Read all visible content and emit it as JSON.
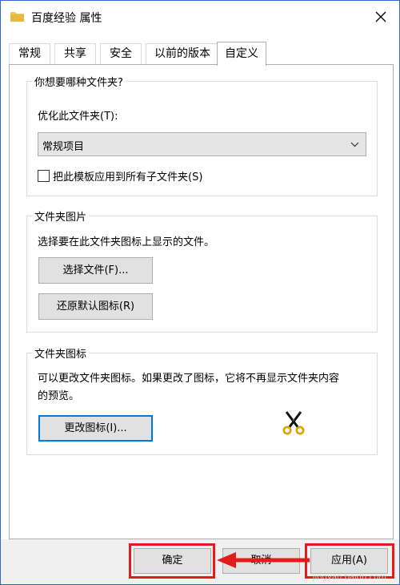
{
  "window": {
    "title": "百度经验 属性",
    "close_icon": "close-icon"
  },
  "tabs": [
    "常规",
    "共享",
    "安全",
    "以前的版本",
    "自定义"
  ],
  "active_tab_index": 4,
  "section_folder_type": {
    "legend": "你想要哪种文件夹?",
    "optimize_label": "优化此文件夹(T):",
    "dropdown_value": "常规项目",
    "apply_subfolders_label": "把此模板应用到所有子文件夹(S)",
    "apply_subfolders_checked": false
  },
  "section_folder_picture": {
    "legend": "文件夹图片",
    "description": "选择要在此文件夹图标上显示的文件。",
    "choose_file_button": "选择文件(F)...",
    "restore_default_button": "还原默认图标(R)"
  },
  "section_folder_icon": {
    "legend": "文件夹图标",
    "description_line1": "可以更改文件夹图标。如果更改了图标，它将不再显示文件夹内容",
    "description_line2": "的预览。",
    "change_icon_button": "更改图标(I)..."
  },
  "footer": {
    "ok_button": "确定",
    "cancel_button": "取消",
    "apply_button": "应用(A)"
  },
  "annotation": {
    "highlight_color": "#e31b1b"
  },
  "watermark": "jingyan.baidu.com",
  "colors": {
    "button_face": "#e1e1e1",
    "focus_border": "#0078d7",
    "window_border": "#2b6bc9"
  }
}
